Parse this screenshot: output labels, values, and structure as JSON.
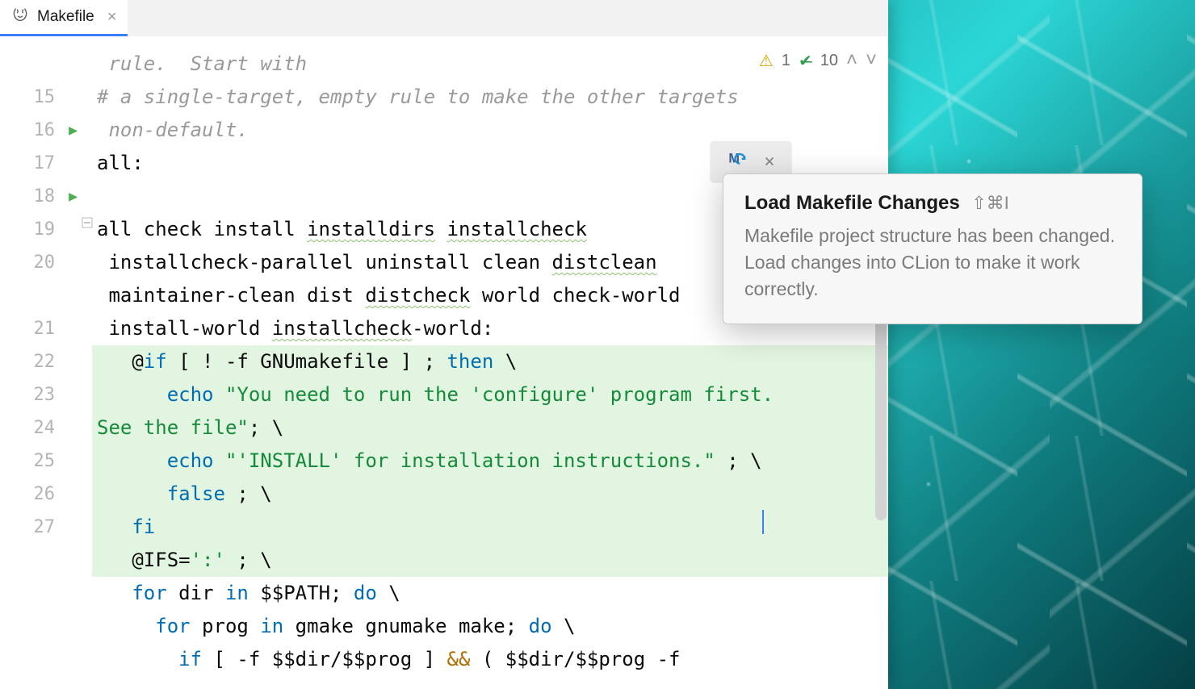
{
  "tab": {
    "label": "Makefile"
  },
  "inspection": {
    "warnings": "1",
    "passes": "10"
  },
  "tooltip": {
    "title": "Load Makefile Changes",
    "shortcut": "⇧⌘I",
    "body": "Makefile project structure has been changed. Load changes into CLion to make it work correctly."
  },
  "gutter": [
    "",
    "15",
    "16",
    "17",
    "18",
    "19",
    "20",
    "21",
    "22",
    "23",
    "24",
    "25",
    "26",
    "27"
  ],
  "code": {
    "l14a": "rule.  Start with",
    "l15": "# a single-target, empty rule to make the other targets non-default.",
    "l16": "all:",
    "l17": "",
    "l18": "all check install installdirs installcheck installcheck-parallel uninstall clean distclean maintainer-clean dist distcheck world check-world install-world installcheck-world:",
    "l19": "   @if [ ! -f GNUmakefile ] ; then \\\\",
    "l20": "      echo \"You need to run the 'configure' program first. See the file\"; \\\\",
    "l21": "      echo \"'INSTALL' for installation instructions.\" ; \\\\",
    "l22": "      false ; \\\\",
    "l23": "   fi",
    "l24": "   @IFS=':' ; \\\\",
    "l25": "   for dir in $$PATH; do \\\\",
    "l26": "     for prog in gmake gnumake make; do \\\\",
    "l27": "       if [ -f $$dir/$$prog ] && ( $$dir/$$prog -f"
  }
}
